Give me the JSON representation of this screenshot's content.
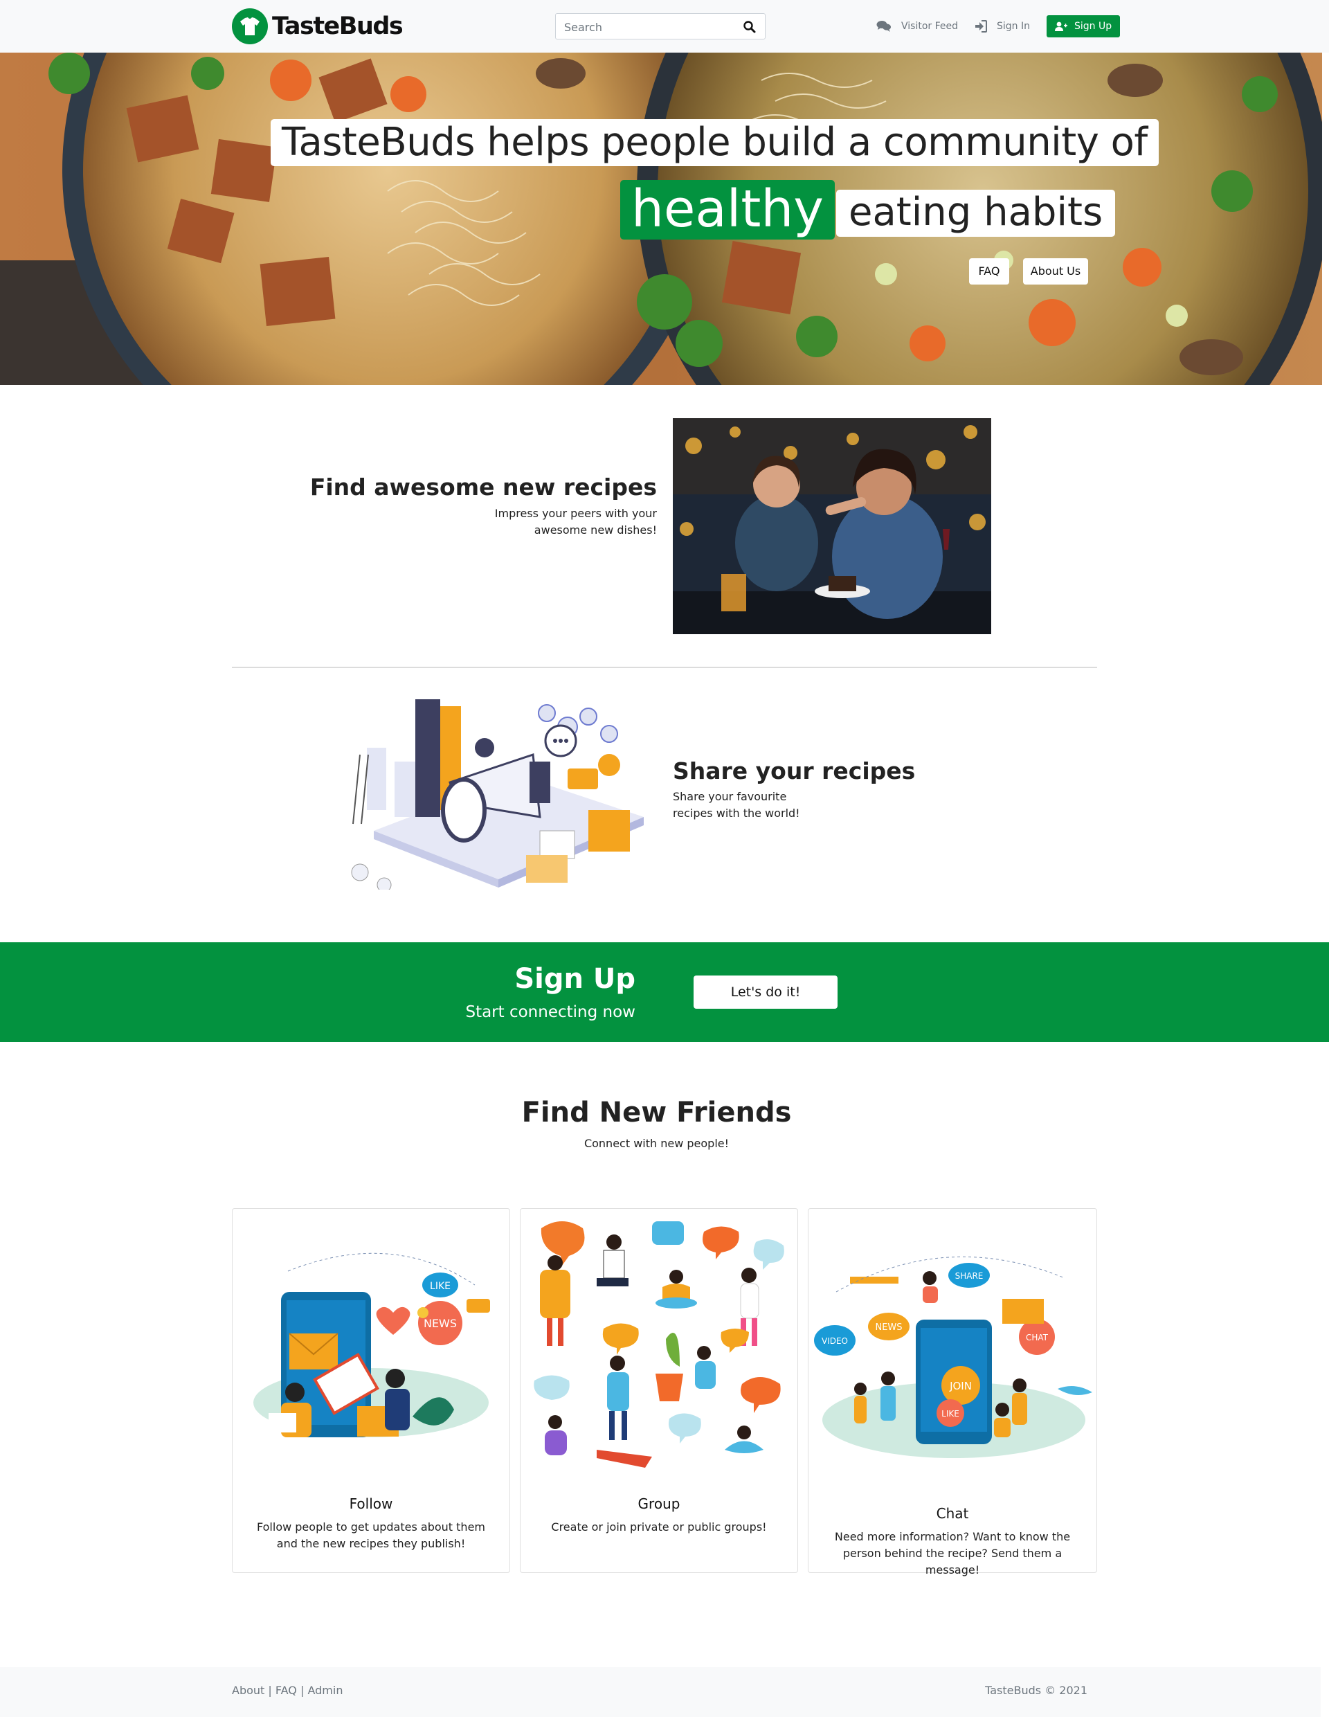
{
  "navbar": {
    "brand": "TasteBuds",
    "search_placeholder": "Search",
    "visitor_feed": "Visitor Feed",
    "sign_in": "Sign In",
    "sign_up": "Sign Up"
  },
  "hero": {
    "line1": "TasteBuds helps people build a community of",
    "highlight": "healthy",
    "line2": "eating habits",
    "faq_button": "FAQ",
    "about_button": "About Us"
  },
  "feature1": {
    "title": "Find awesome new recipes",
    "description": "Impress your peers with your awesome new dishes!"
  },
  "feature2": {
    "title": "Share your recipes",
    "description": "Share your favourite recipes with the world!"
  },
  "cta": {
    "title": "Sign Up",
    "subtitle": "Start connecting now",
    "button": "Let's do it!"
  },
  "friends": {
    "title": "Find New Friends",
    "subtitle": "Connect with new people!",
    "cards": [
      {
        "title": "Follow",
        "text": "Follow people to get updates about them and the new recipes they publish!",
        "bubbles": [
          "LIKE",
          "NEWS"
        ]
      },
      {
        "title": "Group",
        "text": "Create or join private or public groups!"
      },
      {
        "title": "Chat",
        "text": "Need more information? Want to know the person behind the recipe? Send them a message!",
        "bubbles": [
          "SHARE",
          "NEWS",
          "VIDEO",
          "CHAT",
          "JOIN",
          "LIKE"
        ]
      }
    ]
  },
  "footer": {
    "link_about": "About",
    "link_faq": "FAQ",
    "link_admin": "Admin",
    "separator": "|",
    "copyright": "TasteBuds © 2021"
  },
  "colors": {
    "brand_green": "#03923f",
    "navbar_bg": "#f8f9fa",
    "footer_text": "#6c757d"
  },
  "icons": [
    "tshirt-logo-icon",
    "search-icon",
    "comments-icon",
    "sign-in-icon",
    "user-plus-icon"
  ]
}
